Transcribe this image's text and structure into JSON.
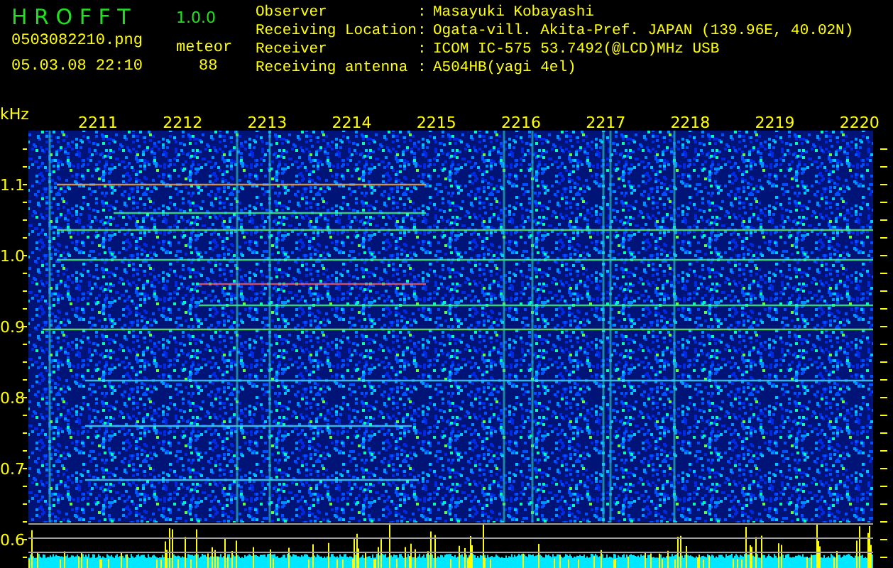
{
  "app": {
    "name": "H R O F F T",
    "version": "1.0.0"
  },
  "file": {
    "name": "0503082210.png",
    "datetime": "05.03.08 22:10"
  },
  "meteor": {
    "label": "meteor",
    "count": "88"
  },
  "station_info": [
    {
      "label": "Observer",
      "separator": ":",
      "value": "Masayuki Kobayashi"
    },
    {
      "label": "Receiving Location",
      "separator": ":",
      "value": "Ogata-vill. Akita-Pref. JAPAN (139.96E, 40.02N)"
    },
    {
      "label": "Receiver",
      "separator": ":",
      "value": "ICOM IC-575 53.7492(@LCD)MHz USB"
    },
    {
      "label": "Receiving antenna",
      "separator": ":",
      "value": "A504HB(yagi 4el)"
    }
  ],
  "spectrogram": {
    "unit": "kHz",
    "time_labels": [
      "2211",
      "2212",
      "2213",
      "2214",
      "2215",
      "2216",
      "2217",
      "2218",
      "2219",
      "2220"
    ],
    "frequency_labels": [
      "1.1",
      "1.0",
      "0.9",
      "0.8",
      "0.7",
      "0.6"
    ]
  }
}
